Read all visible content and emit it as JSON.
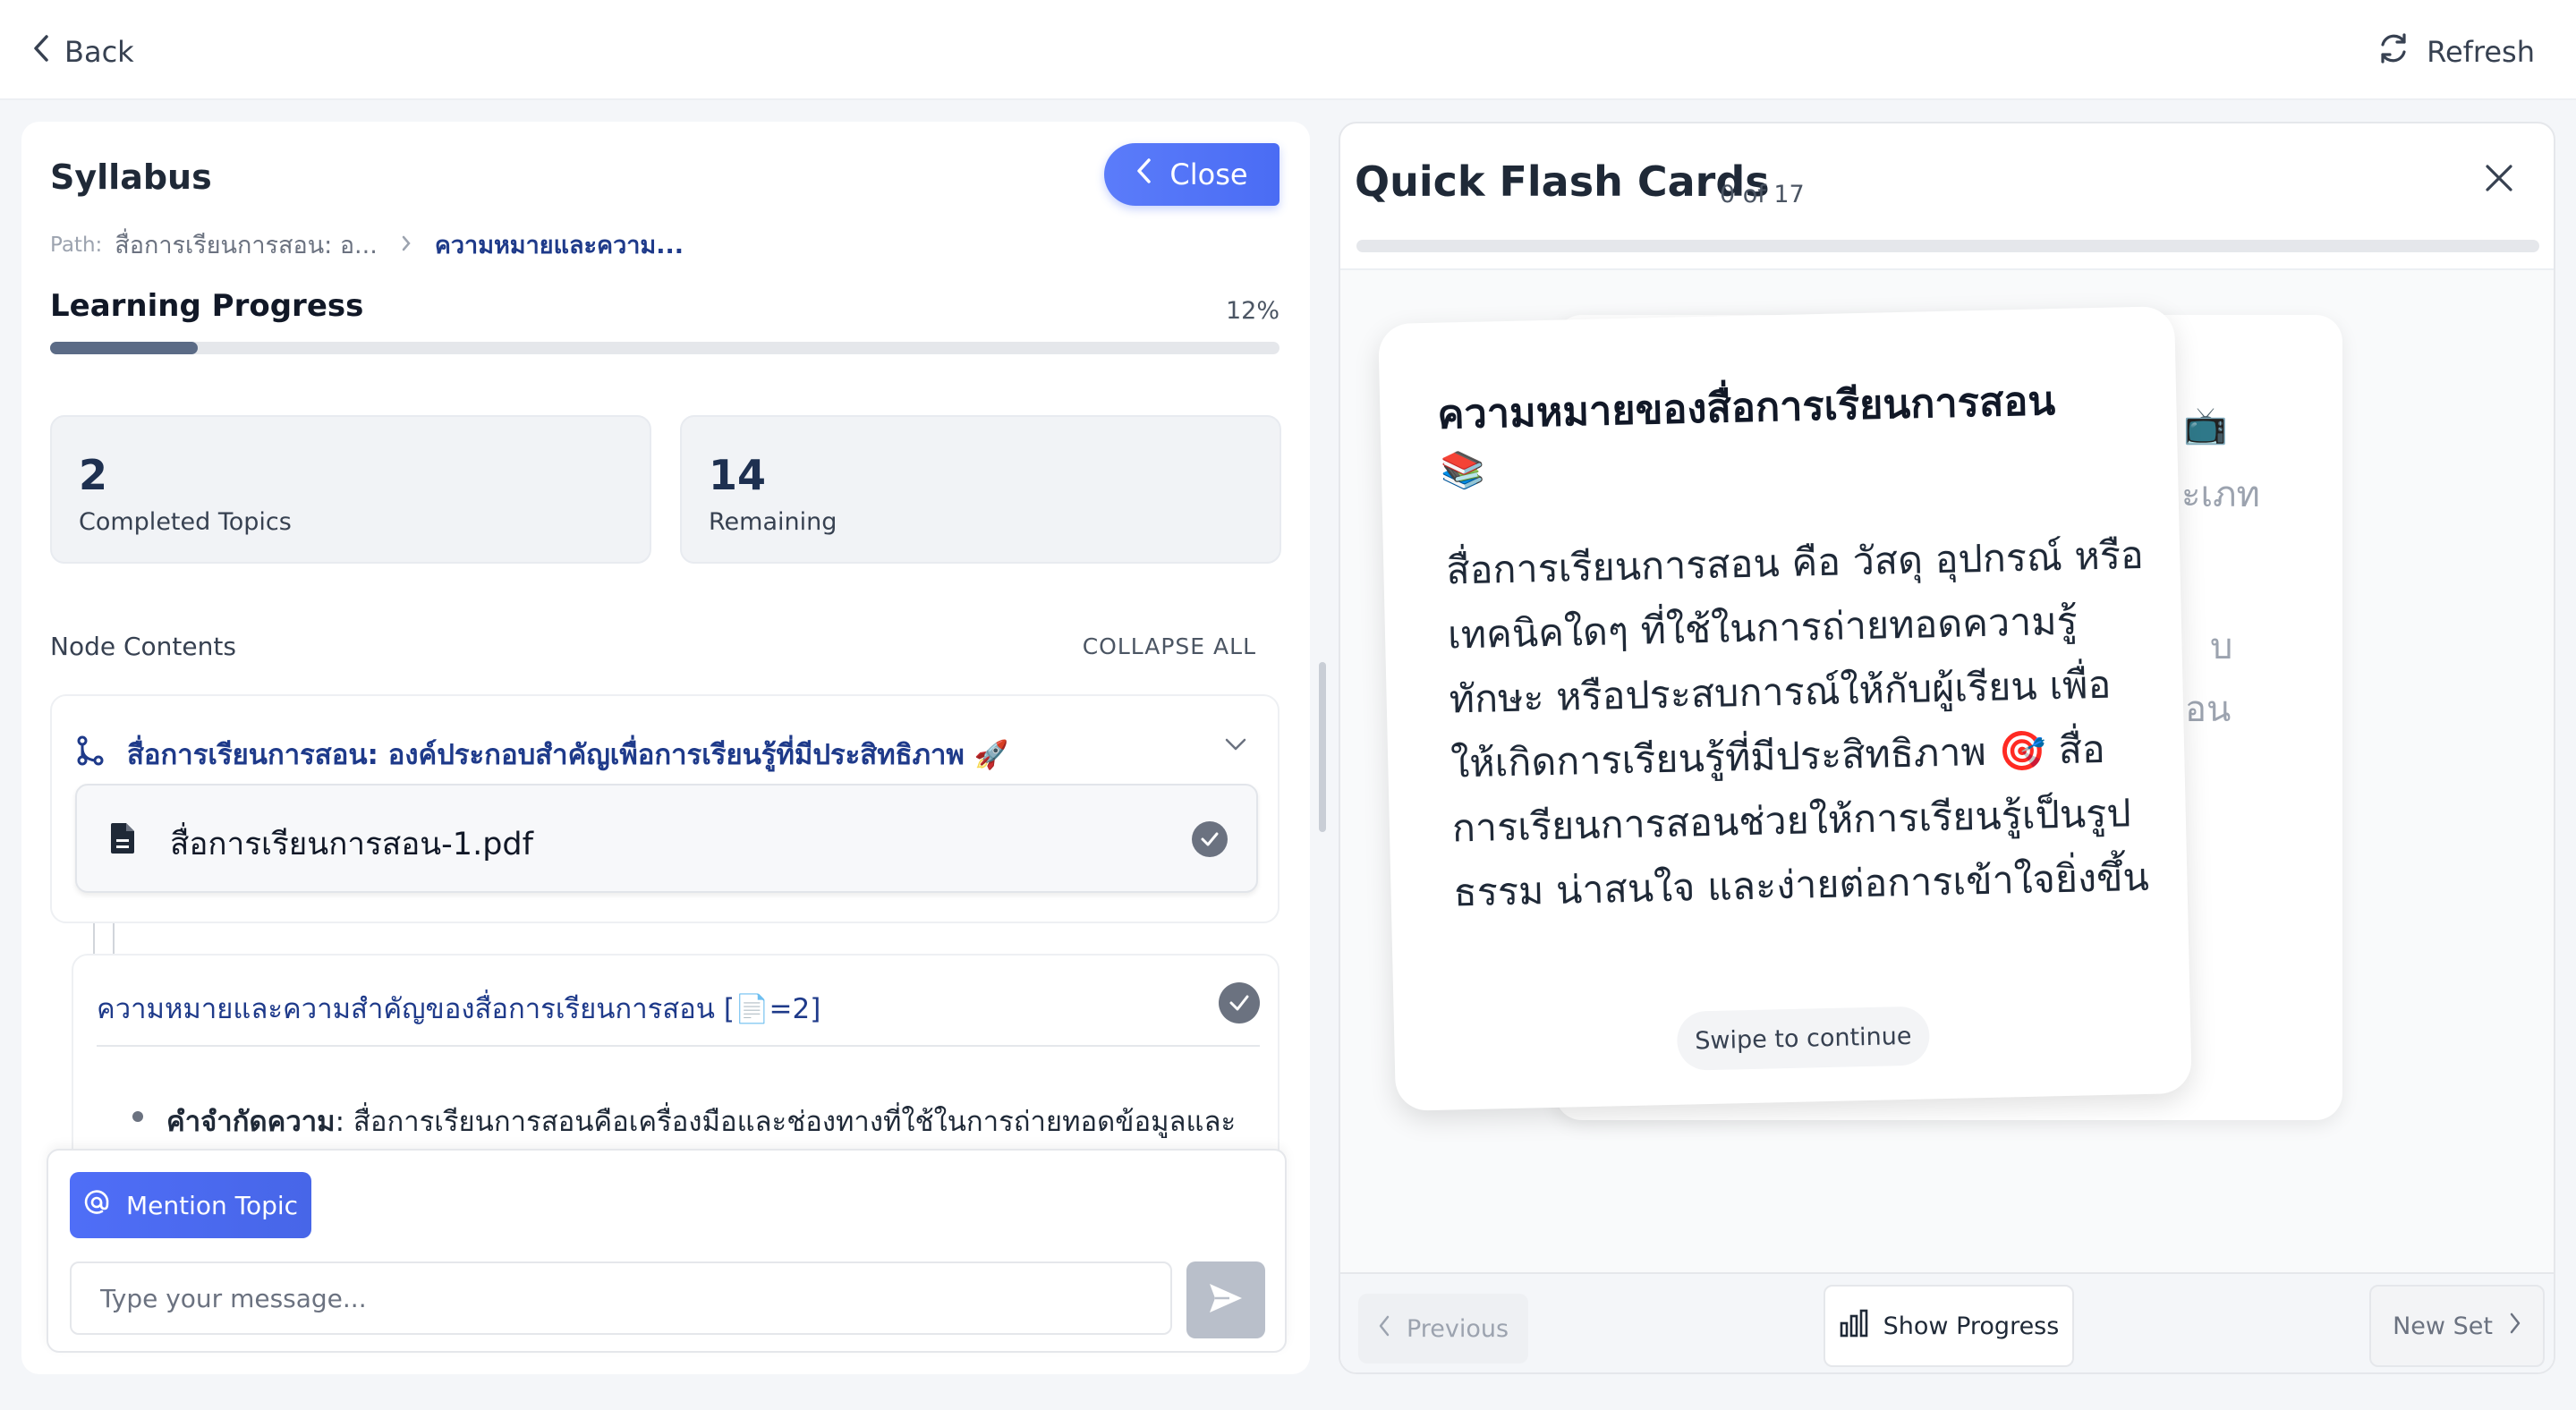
{
  "topbar": {
    "back_label": "Back",
    "refresh_label": "Refresh"
  },
  "syllabus": {
    "title": "Syllabus",
    "close_label": "Close",
    "path_label": "Path:",
    "path_crumb_1": "สื่อการเรียนการสอน: อ...",
    "path_crumb_2": "ความหมายและความ...",
    "progress_title": "Learning Progress",
    "progress_percent_label": "12%",
    "progress_value": 0.12,
    "completed_count": "2",
    "completed_label": "Completed Topics",
    "remaining_count": "14",
    "remaining_label": "Remaining",
    "node_contents_label": "Node Contents",
    "collapse_all_label": "COLLAPSE ALL",
    "node_header": "สื่อการเรียนการสอน: องค์ประกอบสำคัญเพื่อการเรียนรู้ที่มีประสิทธิภาพ 🚀",
    "pdf_name": "สื่อการเรียนการสอน-1.pdf",
    "topic_title": "ความหมายและความสำคัญของสื่อการเรียนการสอน [📄=2]",
    "bullet_term": "คำจำกัดความ",
    "bullet_text": ": สื่อการเรียนการสอนคือเครื่องมือและช่องทางที่ใช้ในการถ่ายทอดข้อมูลและ"
  },
  "chat": {
    "mention_label": "Mention Topic",
    "input_placeholder": "Type your message..."
  },
  "flashcards": {
    "title": "Quick Flash Cards",
    "counter": "0 of 17",
    "progress_value": 0.0,
    "card_title": "ความหมายของสื่อการเรียนการสอน",
    "card_title_emoji": "📚",
    "card_body": "สื่อการเรียนการสอน คือ วัสดุ อุปกรณ์ หรือเทคนิคใดๆ ที่ใช้ในการถ่ายทอดความรู้ ทักษะ หรือประสบการณ์ให้กับผู้เรียน เพื่อให้เกิดการเรียนรู้ที่มีประสิทธิภาพ 🎯 สื่อการเรียนการสอนช่วยให้การเรียนรู้เป็นรูปธรรม น่าสนใจ และง่ายต่อการเข้าใจยิ่งขึ้น",
    "swipe_label": "Swipe to continue",
    "back_card_emoji": "📺",
    "back_card_frag_1": "ะเภท",
    "back_card_frag_2": "บ",
    "back_card_frag_3": "อน",
    "prev_label": "Previous",
    "show_progress_label": "Show Progress",
    "new_set_label": "New Set"
  },
  "colors": {
    "accent": "#4a6cf4",
    "progress_fill": "#5b6b86",
    "heading_blue": "#1e3a8a"
  }
}
